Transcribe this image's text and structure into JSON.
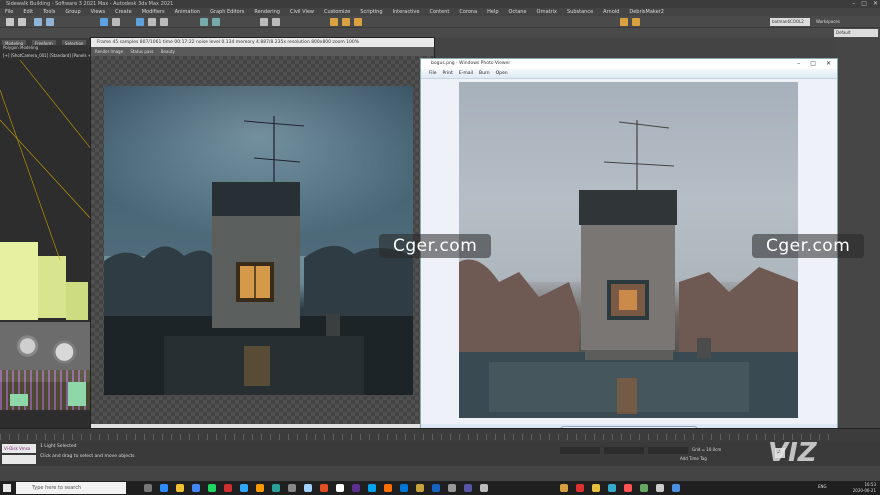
{
  "max": {
    "title": "Sidewalk Building - Software 3 2021 Max - Autodesk 3ds Max 2021",
    "menu": [
      "File",
      "Edit",
      "Tools",
      "Group",
      "Views",
      "Create",
      "Modifiers",
      "Animation",
      "Graph Editors",
      "Rendering",
      "Civil View",
      "Customize",
      "Scripting",
      "Interactive",
      "Content",
      "Corona",
      "Help",
      "Octane",
      "Ornatrix",
      "Substance",
      "Arnold",
      "DebrisMaker2"
    ],
    "ribbon_tabs": [
      "Modeling",
      "Freeform",
      "Selection"
    ],
    "ribbon_sub": "Polygon Modeling",
    "viewport_label": "[+] [ShotCamera_001] [Standard] [Panels + Edges]",
    "workspace_label": "Workspaces",
    "workspace_value": "Default",
    "user": "batman6COOL2"
  },
  "framebuffer": {
    "title": "Frame 45 samples 807/1061 time 00:17:22 noise level 0.134 memory 4.887/8.235x resolution 800x800 zoom 100%",
    "toolbar": [
      "Render Image",
      "Status pass",
      "Beauty"
    ]
  },
  "photoviewer": {
    "title": "bogus.png - Windows Photo Viewer",
    "menu": [
      "File",
      "Print",
      "E-mail",
      "Burn",
      "Open"
    ]
  },
  "watermarks": [
    "Cger.com",
    "Cger.com"
  ],
  "status": {
    "script_label": "Vi-Disk Vmsa",
    "selection": "1 Light Selected",
    "hint": "Click and drag to select and move objects",
    "grid": "Grid = 10.0cm",
    "add_time_tag": "Add Time Tag"
  },
  "taskbar": {
    "search_placeholder": "Type here to search",
    "time": "16:53",
    "date": "2020-06-21",
    "lang": "ENG"
  },
  "logo": "VIZ",
  "colors": {
    "max_bg": "#444444",
    "viewer_frame": "#eef2f8",
    "accent_blue": "#3a7bd5"
  }
}
